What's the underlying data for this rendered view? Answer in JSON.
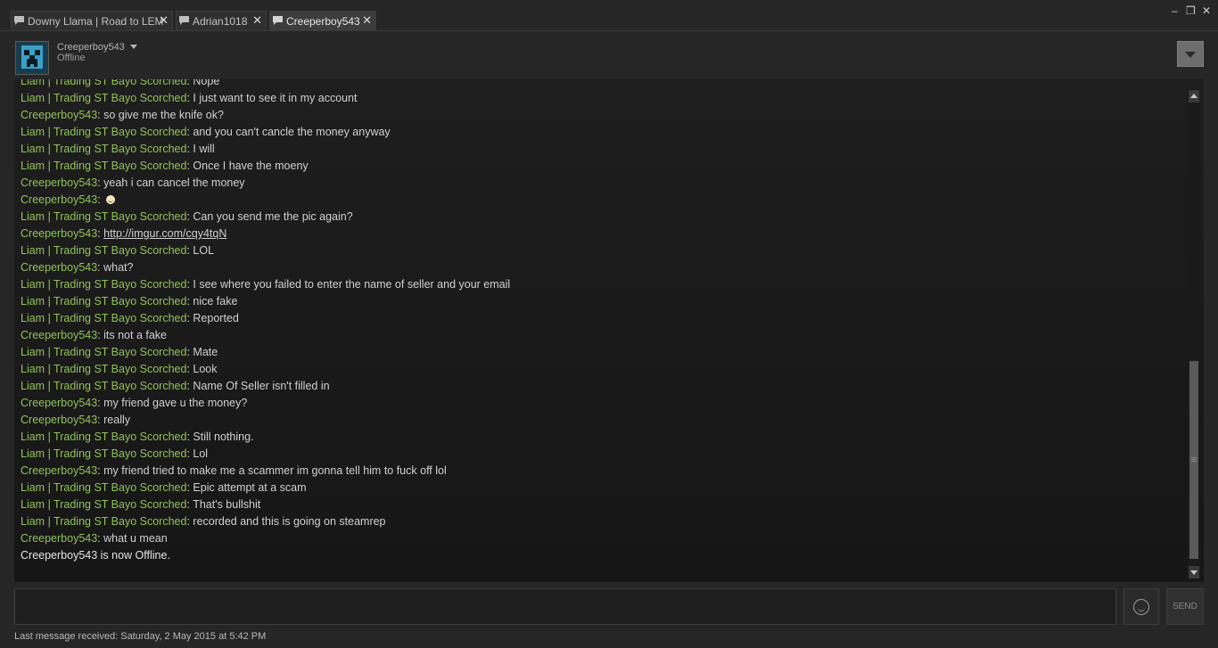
{
  "tabs": [
    {
      "label": "Downy Llama | Road to LEM",
      "active": false,
      "icon": "chat-bubble-icon"
    },
    {
      "label": "Adrian1018",
      "active": false,
      "icon": "chat-bubble-icon"
    },
    {
      "label": "Creeperboy543",
      "active": true,
      "icon": "chat-bubble-icon"
    }
  ],
  "tab_close_symbol": "✕",
  "window_controls": {
    "minimize": "–",
    "restore": "❐",
    "close": "✕"
  },
  "header": {
    "username": "Creeperboy543",
    "status": "Offline",
    "avatar": "creeper-avatar"
  },
  "messages": [
    {
      "sender": "Liam | Trading ST Bayo Scorched",
      "text": "Nope"
    },
    {
      "sender": "Liam | Trading ST Bayo Scorched",
      "text": "I just want to see it in my account"
    },
    {
      "sender": "Creeperboy543",
      "text": "so give me the knife ok?"
    },
    {
      "sender": "Liam | Trading ST Bayo Scorched",
      "text": "and you can't cancle the money anyway"
    },
    {
      "sender": "Liam | Trading ST Bayo Scorched",
      "text": "I will"
    },
    {
      "sender": "Liam | Trading ST Bayo Scorched",
      "text": "Once I have the moeny"
    },
    {
      "sender": "Creeperboy543",
      "text": "yeah i can cancel the money"
    },
    {
      "sender": "Creeperboy543",
      "text": "",
      "emoticon": "smiley-icon"
    },
    {
      "sender": "Liam | Trading ST Bayo Scorched",
      "text": "Can you send me the pic again?"
    },
    {
      "sender": "Creeperboy543",
      "text": "http://imgur.com/cqy4tqN",
      "link": true
    },
    {
      "sender": "Liam | Trading ST Bayo Scorched",
      "text": "LOL"
    },
    {
      "sender": "Creeperboy543",
      "text": "what?"
    },
    {
      "sender": "Liam | Trading ST Bayo Scorched",
      "text": "I see where you failed to enter the name of seller and your email"
    },
    {
      "sender": "Liam | Trading ST Bayo Scorched",
      "text": "nice fake"
    },
    {
      "sender": "Liam | Trading ST Bayo Scorched",
      "text": "Reported"
    },
    {
      "sender": "Creeperboy543",
      "text": "its not a fake"
    },
    {
      "sender": "Liam | Trading ST Bayo Scorched",
      "text": "Mate"
    },
    {
      "sender": "Liam | Trading ST Bayo Scorched",
      "text": "Look"
    },
    {
      "sender": "Liam | Trading ST Bayo Scorched",
      "text": "Name Of Seller isn't filled in"
    },
    {
      "sender": "Creeperboy543",
      "text": "my friend gave u the money?"
    },
    {
      "sender": "Creeperboy543",
      "text": "really"
    },
    {
      "sender": "Liam | Trading ST Bayo Scorched",
      "text": "Still nothing."
    },
    {
      "sender": "Liam | Trading ST Bayo Scorched",
      "text": "Lol"
    },
    {
      "sender": "Creeperboy543",
      "text": "my friend tried to make me a scammer im gonna tell him to fuck off lol"
    },
    {
      "sender": "Liam | Trading ST Bayo Scorched",
      "text": "Epic attempt at a scam"
    },
    {
      "sender": "Liam | Trading ST Bayo Scorched",
      "text": "That's bullshit"
    },
    {
      "sender": "Liam | Trading ST Bayo Scorched",
      "text": "recorded and this is going on steamrep"
    },
    {
      "sender": "Creeperboy543",
      "text": "what u mean"
    }
  ],
  "system_message": "Creeperboy543 is now Offline.",
  "input": {
    "value": "",
    "placeholder": ""
  },
  "emoticon_button_icon": "smiley-face-icon",
  "send_label": "SEND",
  "footer": "Last message received: Saturday, 2 May 2015 at 5:42 PM",
  "colors": {
    "sender": "#91c257",
    "background": "#262626",
    "chat_bg": "#1a1a1a"
  }
}
